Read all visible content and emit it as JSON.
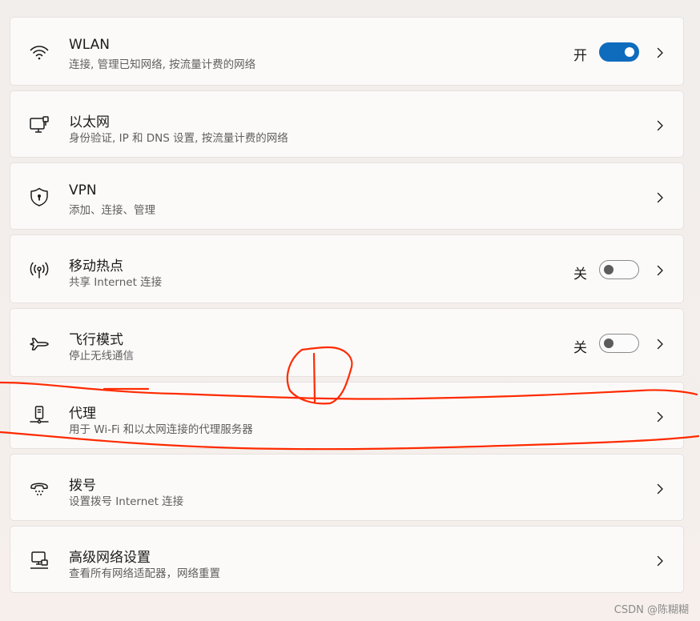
{
  "settings": [
    {
      "id": "wlan",
      "title": "WLAN",
      "subtitle": "连接, 管理已知网络, 按流量计费的网络",
      "icon": "wifi-icon",
      "toggle": true,
      "state_label": "开",
      "toggle_on": true
    },
    {
      "id": "ethernet",
      "title": "以太网",
      "subtitle": "身份验证, IP 和 DNS 设置, 按流量计费的网络",
      "icon": "ethernet-icon",
      "toggle": false
    },
    {
      "id": "vpn",
      "title": "VPN",
      "subtitle": "添加、连接、管理",
      "icon": "shield-icon",
      "toggle": false
    },
    {
      "id": "hotspot",
      "title": "移动热点",
      "subtitle": "共享 Internet 连接",
      "icon": "hotspot-icon",
      "toggle": true,
      "state_label": "关",
      "toggle_on": false
    },
    {
      "id": "airplane",
      "title": "飞行模式",
      "subtitle": "停止无线通信",
      "icon": "airplane-icon",
      "toggle": true,
      "state_label": "关",
      "toggle_on": false
    },
    {
      "id": "proxy",
      "title": "代理",
      "subtitle": "用于 Wi-Fi 和以太网连接的代理服务器",
      "icon": "proxy-icon",
      "toggle": false
    },
    {
      "id": "dialup",
      "title": "拨号",
      "subtitle": "设置拨号 Internet 连接",
      "icon": "dialup-icon",
      "toggle": false
    },
    {
      "id": "advanced",
      "title": "高级网络设置",
      "subtitle": "查看所有网络适配器，网络重置",
      "icon": "computer-network-icon",
      "toggle": false
    }
  ],
  "watermark": "CSDN @陈糊糊",
  "colors": {
    "accent": "#0f6cbd",
    "annotation": "#ff2a00"
  }
}
